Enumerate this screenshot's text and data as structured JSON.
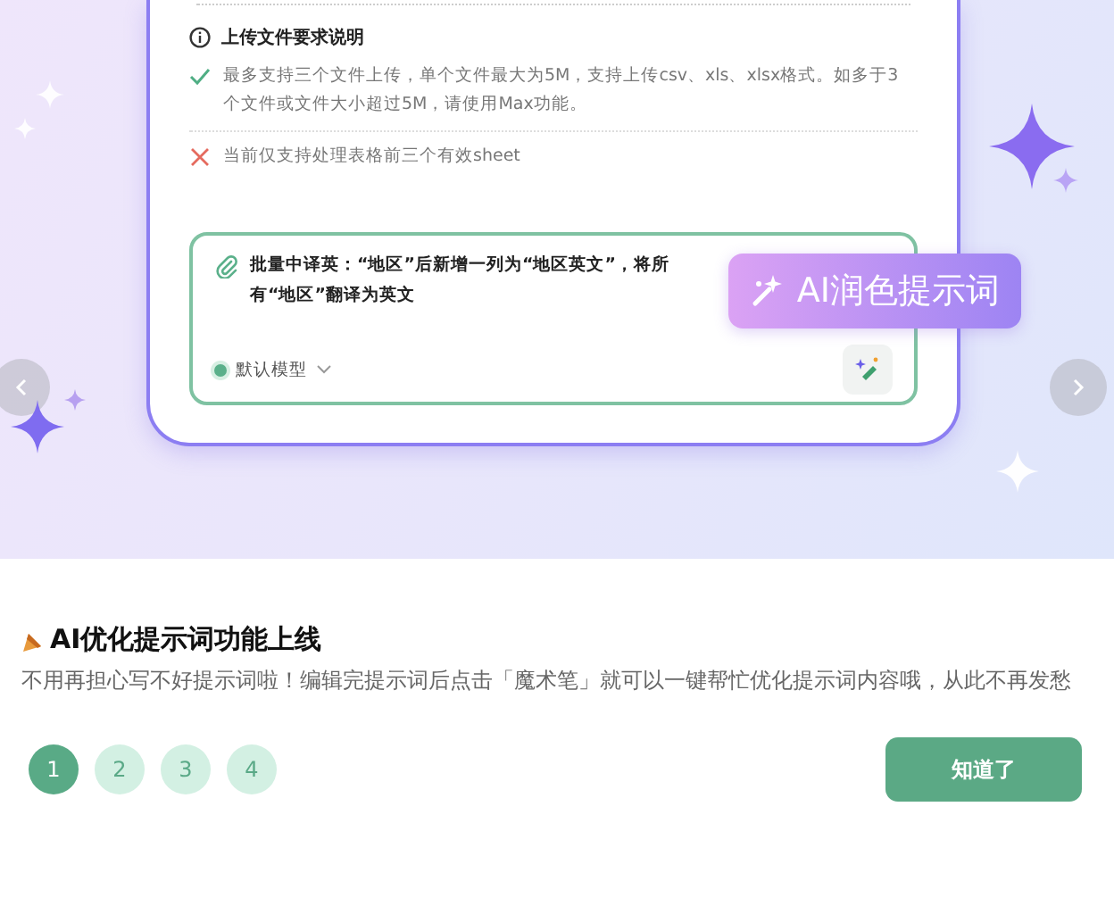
{
  "notice": {
    "title": "上传文件要求说明",
    "items": [
      {
        "kind": "allowed",
        "text": "最多支持三个文件上传，单个文件最大为5M，支持上传csv、xls、xlsx格式。如多于3个文件或文件大小超过5M，请使用Max功能。"
      },
      {
        "kind": "denied",
        "text": "当前仅支持处理表格前三个有效sheet"
      }
    ]
  },
  "prompt_box": {
    "text": "批量中译英：“地区”后新增一列为“地区英文”，将所有“地区”翻译为英文",
    "model": "默认模型",
    "tooltip": "AI润色提示词"
  },
  "feature": {
    "title": "AI优化提示词功能上线",
    "description": "不用再担心写不好提示词啦！编辑完提示词后点击「魔术笔」就可以一键帮忙优化提示词内容哦，从此不再发愁"
  },
  "pages": [
    {
      "label": "1",
      "selected": true
    },
    {
      "label": "2",
      "selected": false
    },
    {
      "label": "3",
      "selected": false
    },
    {
      "label": "4",
      "selected": false
    }
  ],
  "confirm_button": "知道了"
}
